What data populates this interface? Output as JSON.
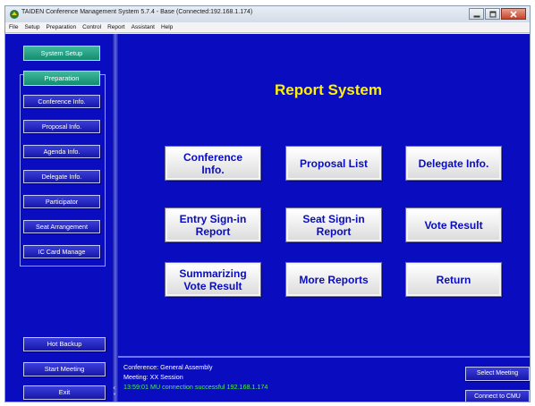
{
  "window": {
    "title": "TAIDEN Conference Management System 5.7.4 - Base (Connected:192.168.1.174)"
  },
  "menu": [
    "File",
    "Setup",
    "Preparation",
    "Control",
    "Report",
    "Assistant",
    "Help"
  ],
  "sidebar": {
    "system_setup": "System Setup",
    "preparation": "Preparation",
    "items": [
      {
        "label": "Conference Info."
      },
      {
        "label": "Proposal Info."
      },
      {
        "label": "Agenda Info."
      },
      {
        "label": "Delegate Info."
      },
      {
        "label": "Participator"
      },
      {
        "label": "Seat Arrangement"
      },
      {
        "label": "IC Card Manage"
      }
    ],
    "hot_backup": "Hot Backup",
    "start_meeting": "Start Meeting",
    "exit": "Exit"
  },
  "main": {
    "title": "Report System",
    "buttons": [
      {
        "line1": "Conference",
        "line2": "Info."
      },
      {
        "line1": "Proposal List",
        "line2": ""
      },
      {
        "line1": "Delegate Info.",
        "line2": ""
      },
      {
        "line1": "Entry Sign-in",
        "line2": "Report"
      },
      {
        "line1": "Seat Sign-in",
        "line2": "Report"
      },
      {
        "line1": "Vote Result",
        "line2": ""
      },
      {
        "line1": "Summarizing",
        "line2": "Vote Result"
      },
      {
        "line1": "More Reports",
        "line2": ""
      },
      {
        "line1": "Return",
        "line2": ""
      }
    ]
  },
  "status": {
    "conference": "Conference: General Assembly",
    "meeting": "Meeting: XX Session",
    "log": "13:59:01 MU connection successful 192.168.1.174",
    "select_meeting": "Select Meeting",
    "connect_cmu": "Connect to CMU"
  },
  "colors": {
    "background": "#0a0cc0",
    "title": "#fff200",
    "button_text": "#0a0cc0",
    "accent_green": "#148c70",
    "log_text": "#4df04d"
  },
  "icons": {
    "app": "app-logo-icon",
    "minimize": "minimize-icon",
    "maximize": "maximize-icon",
    "close": "close-icon",
    "splitter_left": "chevron-left-icon",
    "splitter_down": "chevron-down-icon"
  }
}
